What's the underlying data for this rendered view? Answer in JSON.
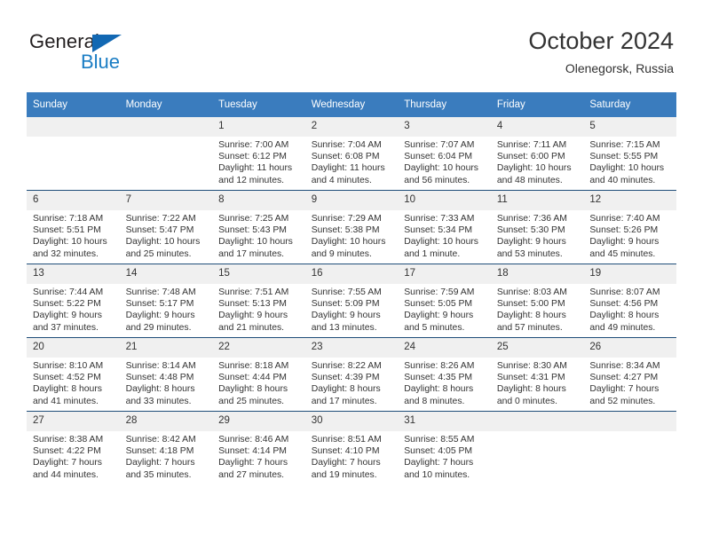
{
  "brand": {
    "name_top": "General",
    "name_bottom": "Blue",
    "accent_color": "#1a7dc4",
    "triangle_color": "#1268b3"
  },
  "header": {
    "title": "October 2024",
    "subtitle": "Olenegorsk, Russia"
  },
  "theme": {
    "header_blue": "#3a7cbe",
    "row_border": "#1f4e79",
    "daynum_background": "#f0f0f0",
    "text_color": "#333333"
  },
  "weekdays": [
    "Sunday",
    "Monday",
    "Tuesday",
    "Wednesday",
    "Thursday",
    "Friday",
    "Saturday"
  ],
  "weeks": [
    [
      {
        "day": "",
        "lines": []
      },
      {
        "day": "",
        "lines": []
      },
      {
        "day": "1",
        "lines": [
          "Sunrise: 7:00 AM",
          "Sunset: 6:12 PM",
          "Daylight: 11 hours",
          "and 12 minutes."
        ]
      },
      {
        "day": "2",
        "lines": [
          "Sunrise: 7:04 AM",
          "Sunset: 6:08 PM",
          "Daylight: 11 hours",
          "and 4 minutes."
        ]
      },
      {
        "day": "3",
        "lines": [
          "Sunrise: 7:07 AM",
          "Sunset: 6:04 PM",
          "Daylight: 10 hours",
          "and 56 minutes."
        ]
      },
      {
        "day": "4",
        "lines": [
          "Sunrise: 7:11 AM",
          "Sunset: 6:00 PM",
          "Daylight: 10 hours",
          "and 48 minutes."
        ]
      },
      {
        "day": "5",
        "lines": [
          "Sunrise: 7:15 AM",
          "Sunset: 5:55 PM",
          "Daylight: 10 hours",
          "and 40 minutes."
        ]
      }
    ],
    [
      {
        "day": "6",
        "lines": [
          "Sunrise: 7:18 AM",
          "Sunset: 5:51 PM",
          "Daylight: 10 hours",
          "and 32 minutes."
        ]
      },
      {
        "day": "7",
        "lines": [
          "Sunrise: 7:22 AM",
          "Sunset: 5:47 PM",
          "Daylight: 10 hours",
          "and 25 minutes."
        ]
      },
      {
        "day": "8",
        "lines": [
          "Sunrise: 7:25 AM",
          "Sunset: 5:43 PM",
          "Daylight: 10 hours",
          "and 17 minutes."
        ]
      },
      {
        "day": "9",
        "lines": [
          "Sunrise: 7:29 AM",
          "Sunset: 5:38 PM",
          "Daylight: 10 hours",
          "and 9 minutes."
        ]
      },
      {
        "day": "10",
        "lines": [
          "Sunrise: 7:33 AM",
          "Sunset: 5:34 PM",
          "Daylight: 10 hours",
          "and 1 minute."
        ]
      },
      {
        "day": "11",
        "lines": [
          "Sunrise: 7:36 AM",
          "Sunset: 5:30 PM",
          "Daylight: 9 hours",
          "and 53 minutes."
        ]
      },
      {
        "day": "12",
        "lines": [
          "Sunrise: 7:40 AM",
          "Sunset: 5:26 PM",
          "Daylight: 9 hours",
          "and 45 minutes."
        ]
      }
    ],
    [
      {
        "day": "13",
        "lines": [
          "Sunrise: 7:44 AM",
          "Sunset: 5:22 PM",
          "Daylight: 9 hours",
          "and 37 minutes."
        ]
      },
      {
        "day": "14",
        "lines": [
          "Sunrise: 7:48 AM",
          "Sunset: 5:17 PM",
          "Daylight: 9 hours",
          "and 29 minutes."
        ]
      },
      {
        "day": "15",
        "lines": [
          "Sunrise: 7:51 AM",
          "Sunset: 5:13 PM",
          "Daylight: 9 hours",
          "and 21 minutes."
        ]
      },
      {
        "day": "16",
        "lines": [
          "Sunrise: 7:55 AM",
          "Sunset: 5:09 PM",
          "Daylight: 9 hours",
          "and 13 minutes."
        ]
      },
      {
        "day": "17",
        "lines": [
          "Sunrise: 7:59 AM",
          "Sunset: 5:05 PM",
          "Daylight: 9 hours",
          "and 5 minutes."
        ]
      },
      {
        "day": "18",
        "lines": [
          "Sunrise: 8:03 AM",
          "Sunset: 5:00 PM",
          "Daylight: 8 hours",
          "and 57 minutes."
        ]
      },
      {
        "day": "19",
        "lines": [
          "Sunrise: 8:07 AM",
          "Sunset: 4:56 PM",
          "Daylight: 8 hours",
          "and 49 minutes."
        ]
      }
    ],
    [
      {
        "day": "20",
        "lines": [
          "Sunrise: 8:10 AM",
          "Sunset: 4:52 PM",
          "Daylight: 8 hours",
          "and 41 minutes."
        ]
      },
      {
        "day": "21",
        "lines": [
          "Sunrise: 8:14 AM",
          "Sunset: 4:48 PM",
          "Daylight: 8 hours",
          "and 33 minutes."
        ]
      },
      {
        "day": "22",
        "lines": [
          "Sunrise: 8:18 AM",
          "Sunset: 4:44 PM",
          "Daylight: 8 hours",
          "and 25 minutes."
        ]
      },
      {
        "day": "23",
        "lines": [
          "Sunrise: 8:22 AM",
          "Sunset: 4:39 PM",
          "Daylight: 8 hours",
          "and 17 minutes."
        ]
      },
      {
        "day": "24",
        "lines": [
          "Sunrise: 8:26 AM",
          "Sunset: 4:35 PM",
          "Daylight: 8 hours",
          "and 8 minutes."
        ]
      },
      {
        "day": "25",
        "lines": [
          "Sunrise: 8:30 AM",
          "Sunset: 4:31 PM",
          "Daylight: 8 hours",
          "and 0 minutes."
        ]
      },
      {
        "day": "26",
        "lines": [
          "Sunrise: 8:34 AM",
          "Sunset: 4:27 PM",
          "Daylight: 7 hours",
          "and 52 minutes."
        ]
      }
    ],
    [
      {
        "day": "27",
        "lines": [
          "Sunrise: 8:38 AM",
          "Sunset: 4:22 PM",
          "Daylight: 7 hours",
          "and 44 minutes."
        ]
      },
      {
        "day": "28",
        "lines": [
          "Sunrise: 8:42 AM",
          "Sunset: 4:18 PM",
          "Daylight: 7 hours",
          "and 35 minutes."
        ]
      },
      {
        "day": "29",
        "lines": [
          "Sunrise: 8:46 AM",
          "Sunset: 4:14 PM",
          "Daylight: 7 hours",
          "and 27 minutes."
        ]
      },
      {
        "day": "30",
        "lines": [
          "Sunrise: 8:51 AM",
          "Sunset: 4:10 PM",
          "Daylight: 7 hours",
          "and 19 minutes."
        ]
      },
      {
        "day": "31",
        "lines": [
          "Sunrise: 8:55 AM",
          "Sunset: 4:05 PM",
          "Daylight: 7 hours",
          "and 10 minutes."
        ]
      },
      {
        "day": "",
        "lines": []
      },
      {
        "day": "",
        "lines": []
      }
    ]
  ]
}
